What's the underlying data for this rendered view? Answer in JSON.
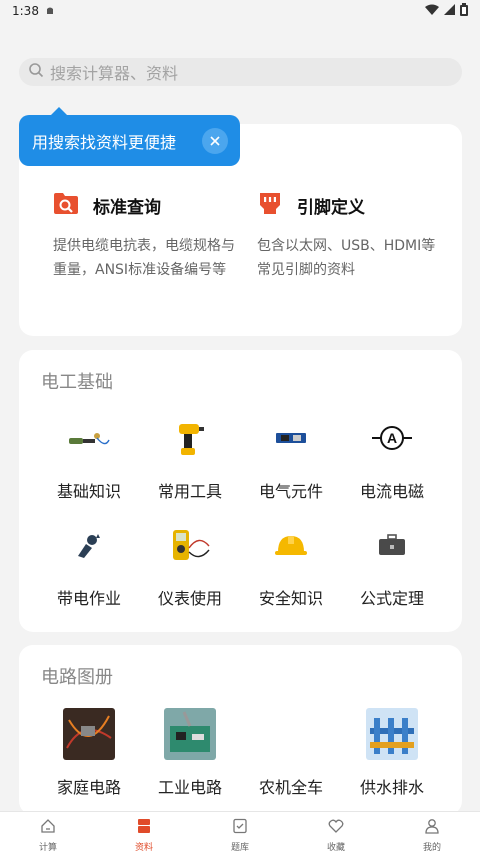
{
  "status": {
    "time": "1:38"
  },
  "search": {
    "placeholder": "搜索计算器、资料"
  },
  "tooltip": {
    "text": "用搜索找资料更便捷"
  },
  "features": [
    {
      "title": "标准查询",
      "desc": "提供电缆电抗表，电缆规格与重量，ANSI标准设备编号等",
      "icon": "folder-search-icon"
    },
    {
      "title": "引脚定义",
      "desc": "包含以太网、USB、HDMI等常见引脚的资料",
      "icon": "connector-icon"
    }
  ],
  "basics": {
    "title": "电工基础",
    "items": [
      {
        "label": "基础知识",
        "icon": "soldering-iron-icon"
      },
      {
        "label": "常用工具",
        "icon": "drill-icon"
      },
      {
        "label": "电气元件",
        "icon": "circuit-board-icon"
      },
      {
        "label": "电流电磁",
        "icon": "ammeter-icon"
      },
      {
        "label": "带电作业",
        "icon": "live-work-icon"
      },
      {
        "label": "仪表使用",
        "icon": "multimeter-icon"
      },
      {
        "label": "安全知识",
        "icon": "helmet-icon"
      },
      {
        "label": "公式定理",
        "icon": "toolbox-icon"
      }
    ]
  },
  "circuits": {
    "title": "电路图册",
    "items": [
      {
        "label": "家庭电路",
        "icon": "home-circuit-photo"
      },
      {
        "label": "工业电路",
        "icon": "industrial-circuit-photo"
      },
      {
        "label": "农机全车",
        "icon": "tractor-icon"
      },
      {
        "label": "供水排水",
        "icon": "water-supply-photo"
      }
    ]
  },
  "tabs": [
    {
      "label": "计算",
      "icon": "home-icon"
    },
    {
      "label": "资料",
      "icon": "book-icon",
      "active": true
    },
    {
      "label": "题库",
      "icon": "checklist-icon"
    },
    {
      "label": "收藏",
      "icon": "heart-icon"
    },
    {
      "label": "我的",
      "icon": "user-icon"
    }
  ],
  "colors": {
    "accent": "#e04b2a",
    "tooltip": "#1f8de6"
  }
}
